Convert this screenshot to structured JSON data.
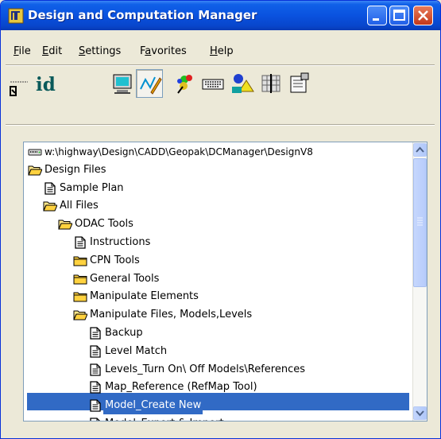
{
  "window": {
    "title": "Design and Computation Manager",
    "controls": [
      "minimize-icon",
      "maximize-icon",
      "close-icon"
    ]
  },
  "menu": [
    {
      "key": "F",
      "rest": "ile"
    },
    {
      "key": "E",
      "rest": "dit"
    },
    {
      "key": "S",
      "rest": "ettings"
    },
    {
      "pre": "F",
      "key": "a",
      "rest": "vorites"
    },
    {
      "key": "H",
      "rest": "elp"
    }
  ],
  "toolbar": {
    "id_label": "id",
    "tools": [
      "text-cursor-icon",
      "id-icon",
      "display-icon",
      "pen-icon",
      "palette-icon",
      "keyboard-icon",
      "shapes-icon",
      "grid-icon",
      "properties-icon"
    ]
  },
  "tree": {
    "items": [
      {
        "label": "w:\\highway\\Design\\CADD\\Geopak\\DCManager\\DesignV8",
        "icon": "drive-icon",
        "level": 0
      },
      {
        "label": "Design Files",
        "icon": "folder-open-icon",
        "level": 0
      },
      {
        "label": "Sample Plan",
        "icon": "document-icon",
        "level": 1
      },
      {
        "label": "All Files",
        "icon": "folder-open-icon",
        "level": 1
      },
      {
        "label": "ODAC Tools",
        "icon": "folder-open-icon",
        "level": 2
      },
      {
        "label": "Instructions",
        "icon": "document-icon",
        "level": 3
      },
      {
        "label": "CPN Tools",
        "icon": "folder-icon",
        "level": 3
      },
      {
        "label": "General Tools",
        "icon": "folder-icon",
        "level": 3
      },
      {
        "label": "Manipulate Elements",
        "icon": "folder-icon",
        "level": 3
      },
      {
        "label": "Manipulate Files, Models,Levels",
        "icon": "folder-open-icon",
        "level": 3
      },
      {
        "label": "Backup",
        "icon": "document-icon",
        "level": 4
      },
      {
        "label": "Level Match",
        "icon": "document-icon",
        "level": 4
      },
      {
        "label": "Levels_Turn On\\ Off Models\\References",
        "icon": "document-icon",
        "level": 4
      },
      {
        "label": "Map_Reference (RefMap Tool)",
        "icon": "document-icon",
        "level": 4
      },
      {
        "label": "Model_Create New",
        "icon": "document-icon",
        "level": 4,
        "selected": true
      },
      {
        "label": "Model_Export & Import",
        "icon": "document-icon",
        "level": 4
      }
    ]
  },
  "colors": {
    "titlebar": "#0a52df",
    "selection": "#316ac5",
    "close": "#c4381a"
  }
}
